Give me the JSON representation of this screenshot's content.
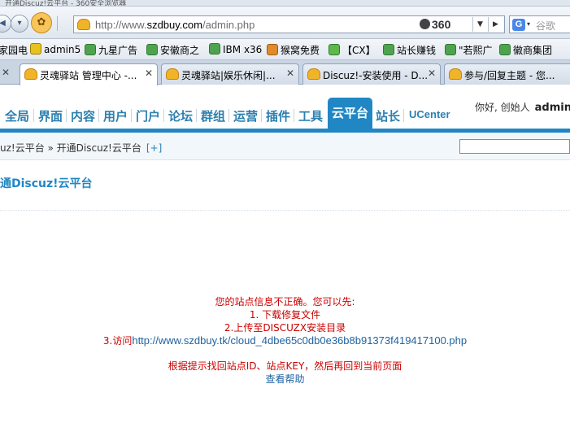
{
  "browser": {
    "top_strip_text": "开通Discuz!云平台 - 360安全浏览器",
    "address_url_prefix": "http://www.",
    "address_url_domain": "szdbuy.com",
    "address_url_suffix": "/admin.php",
    "badge_360": "360",
    "search_placeholder": "谷歌",
    "bookmarks": [
      "家园电",
      "admin5",
      "九星广告",
      "安徽商之",
      "IBM x36",
      "猴窝免费",
      "【CX】",
      "站长赚钱",
      "\"若熙广",
      "徽商集团"
    ],
    "tabs": [
      {
        "label": "灵魂驿站 管理中心 -..."
      },
      {
        "label": "灵魂驿站|娱乐休闲|..."
      },
      {
        "label": "Discuz!-安装使用 - D..."
      },
      {
        "label": "参与/回复主题 - 您..."
      }
    ]
  },
  "admin": {
    "menu": [
      "全局",
      "界面",
      "内容",
      "用户",
      "门户",
      "论坛",
      "群组",
      "运营",
      "插件",
      "工具",
      "云平台",
      "站长"
    ],
    "menu_last": "UCenter",
    "greeting": "你好, 创始人",
    "username": "admin",
    "breadcrumb": "uz!云平台 » 开通Discuz!云平台",
    "breadcrumb_add": "[+]",
    "page_title": "通Discuz!云平台"
  },
  "message": {
    "line1": "您的站点信息不正确。您可以先:",
    "line2": "1. 下载修复文件",
    "line3": "2.上传至DISCUZX安装目录",
    "line4_prefix": "3.访问",
    "line4_link": "http://www.szdbuy.tk/cloud_4dbe65c0db0e36b8b91373f419417100.php",
    "line5": "根据提示找回站点ID、站点KEY，然后再回到当前页面",
    "help": "查看帮助"
  }
}
